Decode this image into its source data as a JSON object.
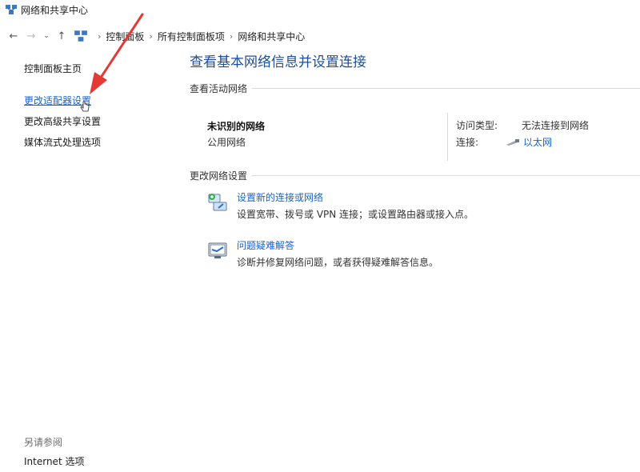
{
  "window": {
    "title": "网络和共享中心"
  },
  "address": {
    "crumbs": [
      "控制面板",
      "所有控制面板项",
      "网络和共享中心"
    ]
  },
  "sidebar": {
    "home": "控制面板主页",
    "items": [
      {
        "label": "更改适配器设置"
      },
      {
        "label": "更改高级共享设置"
      },
      {
        "label": "媒体流式处理选项"
      }
    ],
    "see_also_label": "另请参阅",
    "see_also_items": [
      {
        "label": "Internet 选项"
      }
    ]
  },
  "main": {
    "title": "查看基本网络信息并设置连接",
    "active_section": "查看活动网络",
    "network": {
      "name": "未识别的网络",
      "type": "公用网络",
      "access_label": "访问类型:",
      "access_value": "无法连接到网络",
      "conn_label": "连接:",
      "conn_value": "以太网"
    },
    "change_section": "更改网络设置",
    "tasks": [
      {
        "link": "设置新的连接或网络",
        "desc": "设置宽带、拨号或 VPN 连接；或设置路由器或接入点。",
        "icon": "network-setup-icon"
      },
      {
        "link": "问题疑难解答",
        "desc": "诊断并修复网络问题，或者获得疑难解答信息。",
        "icon": "troubleshoot-icon"
      }
    ]
  },
  "colors": {
    "link": "#1a63c9",
    "title": "#1e4f96",
    "annotation_arrow": "#e53935"
  }
}
